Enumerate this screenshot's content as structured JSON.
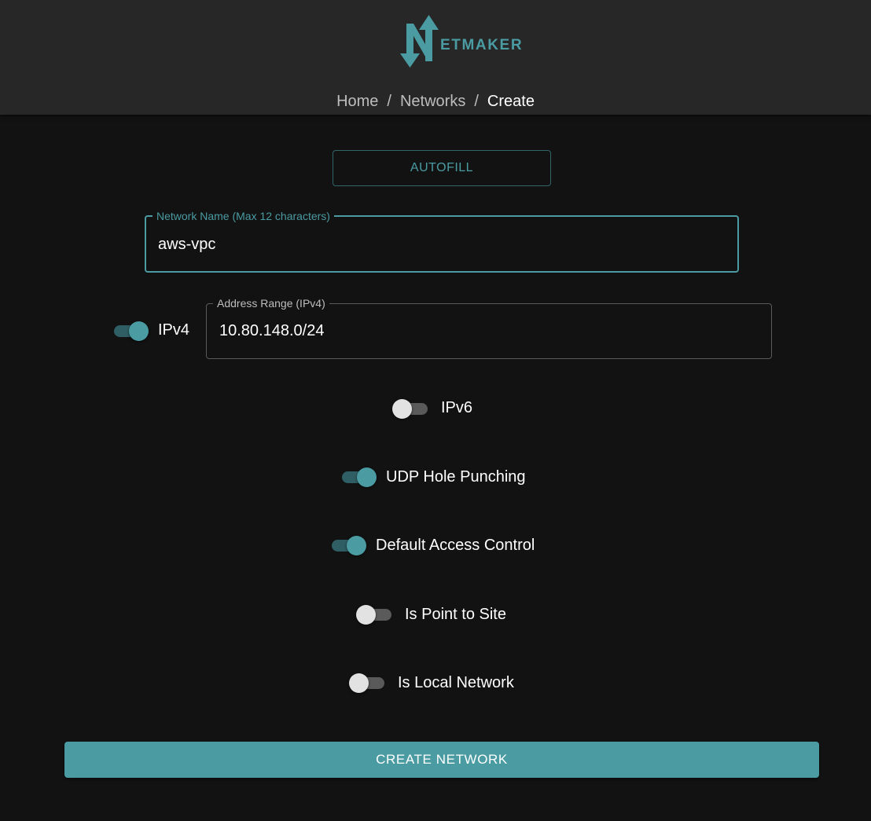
{
  "header": {
    "logo_text": "ETMAKER",
    "breadcrumb": {
      "home": "Home",
      "networks": "Networks",
      "current": "Create",
      "separator": "/"
    }
  },
  "form": {
    "autofill_label": "AUTOFILL",
    "network_name": {
      "label": "Network Name (Max 12 characters)",
      "value": "aws-vpc"
    },
    "ipv4": {
      "label": "IPv4",
      "enabled": true,
      "range_label": "Address Range (IPv4)",
      "range_value": "10.80.148.0/24"
    },
    "ipv6": {
      "label": "IPv6",
      "enabled": false
    },
    "udp_hole_punching": {
      "label": "UDP Hole Punching",
      "enabled": true
    },
    "default_access_control": {
      "label": "Default Access Control",
      "enabled": true
    },
    "is_point_to_site": {
      "label": "Is Point to Site",
      "enabled": false
    },
    "is_local_network": {
      "label": "Is Local Network",
      "enabled": false
    },
    "submit_label": "CREATE NETWORK"
  },
  "colors": {
    "accent": "#4a9ba2",
    "background": "#121212",
    "header": "#272727",
    "switch_off_thumb": "#e2e2e2",
    "switch_off_track": "#5a5a5a"
  },
  "icons": {
    "logo": "netmaker-n-arrows-icon"
  }
}
